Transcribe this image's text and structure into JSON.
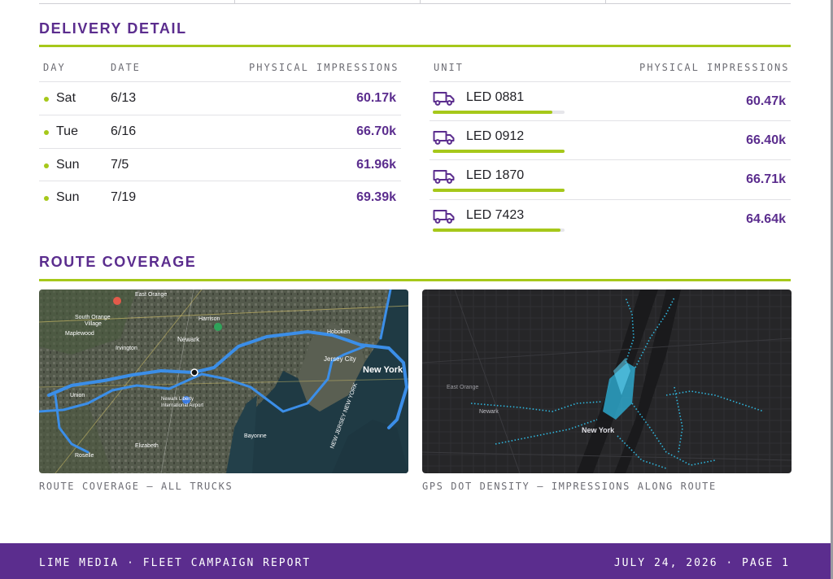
{
  "delivery": {
    "title": "DELIVERY DETAIL",
    "days_table": {
      "headers": {
        "day": "DAY",
        "date": "DATE",
        "impressions": "PHYSICAL IMPRESSIONS"
      },
      "rows": [
        {
          "day": "Sat",
          "date": "6/13",
          "impressions": "60.17k"
        },
        {
          "day": "Tue",
          "date": "6/16",
          "impressions": "66.70k"
        },
        {
          "day": "Sun",
          "date": "7/5",
          "impressions": "61.96k"
        },
        {
          "day": "Sun",
          "date": "7/19",
          "impressions": "69.39k"
        }
      ]
    },
    "units_table": {
      "headers": {
        "unit": "UNIT",
        "impressions": "PHYSICAL IMPRESSIONS"
      },
      "rows": [
        {
          "unit": "LED 0881",
          "impressions": "60.47k",
          "bar_fraction": 0.91
        },
        {
          "unit": "LED 0912",
          "impressions": "66.40k",
          "bar_fraction": 1.0
        },
        {
          "unit": "LED 1870",
          "impressions": "66.71k",
          "bar_fraction": 1.0
        },
        {
          "unit": "LED 7423",
          "impressions": "64.64k",
          "bar_fraction": 0.97
        }
      ]
    }
  },
  "route": {
    "title": "ROUTE COVERAGE",
    "map_left": {
      "caption": "ROUTE COVERAGE — ALL TRUCKS",
      "labels": [
        "East Orange",
        "South Orange Village",
        "Maplewood",
        "Harrison",
        "Newark",
        "Irvington",
        "Hoboken",
        "Jersey City",
        "New York",
        "Union",
        "Newark Liberty International Airport",
        "Elizabeth",
        "Bayonne",
        "Roselle",
        "NEW JERSEY NEW YORK"
      ]
    },
    "map_right": {
      "caption": "GPS DOT DENSITY — IMPRESSIONS ALONG ROUTE",
      "labels": [
        "East Orange",
        "Newark",
        "New York"
      ]
    }
  },
  "footer": {
    "left": "LIME MEDIA · FLEET CAMPAIGN REPORT",
    "right": "JULY 24, 2026 · PAGE 1"
  },
  "colors": {
    "accent_purple": "#5b2d8e",
    "accent_lime": "#a6c81a",
    "route_blue": "#3b8ee8",
    "gps_cyan": "#2fb8e0"
  },
  "icons": {
    "unit_icon": "truck-icon",
    "row_marker": "dot-marker"
  }
}
